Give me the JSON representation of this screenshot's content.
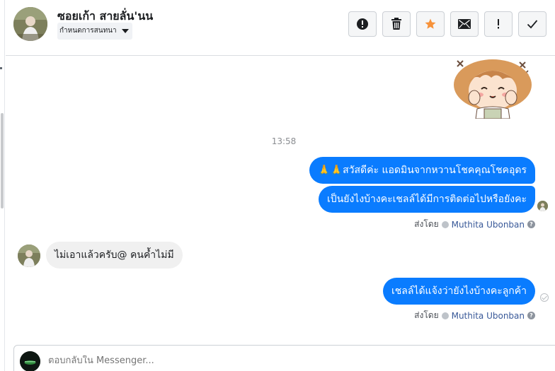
{
  "header": {
    "contact_name": "ซอยเก้า สายลั่น'นน",
    "assign_label": "กำหนดการสนทนา",
    "toolbar": [
      {
        "name": "report-spam-button",
        "icon": "alert-circle-icon"
      },
      {
        "name": "delete-button",
        "icon": "trash-icon"
      },
      {
        "name": "star-button",
        "icon": "star-icon",
        "color": "#f7923a"
      },
      {
        "name": "mark-unread-button",
        "icon": "envelope-icon"
      },
      {
        "name": "follow-up-button",
        "icon": "exclamation-icon"
      },
      {
        "name": "mark-done-button",
        "icon": "checkmark-icon"
      }
    ]
  },
  "conversation": {
    "timestamp": "13:58",
    "messages": [
      {
        "direction": "out",
        "text": "🙏🙏สวัสดีค่ะ แอดมินจากหวานโชคคุณโชคอุดร"
      },
      {
        "direction": "out",
        "text": "เป็นยังไงบ้างคะเชลล์ได้มีการติดต่อไปหรือยังคะ"
      },
      {
        "direction": "in",
        "text": "ไม่เอาแล้วครับ@ คนค้ำไม่มี"
      },
      {
        "direction": "out",
        "text": "เชลล์ได้แจ้งว่ายังไงบ้างคะลูกค้า"
      }
    ],
    "sent_by_prefix": "ส่งโดย",
    "sent_by_name": "Muthita Ubonban"
  },
  "composer": {
    "placeholder": "ตอบกลับใน Messenger..."
  },
  "colors": {
    "outgoing_bubble": "#0a7cff",
    "incoming_bubble": "#f0f0f0",
    "star": "#f7923a"
  }
}
